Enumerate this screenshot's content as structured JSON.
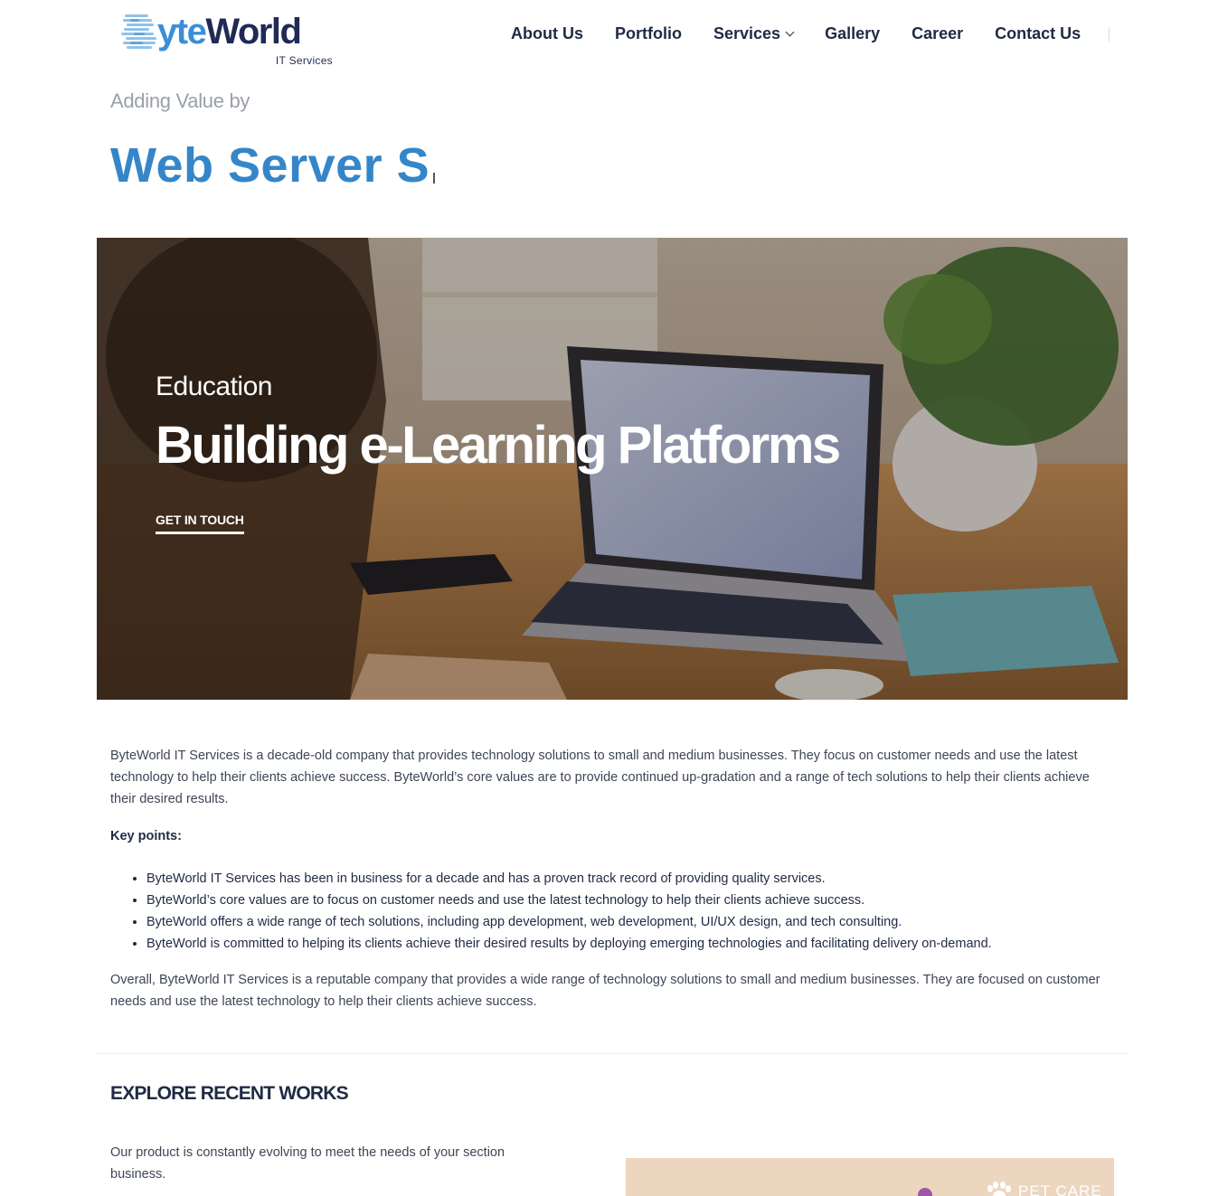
{
  "brand": {
    "logo_prefix": "yte",
    "logo_suffix": "World",
    "logo_tagline": "IT Services",
    "primary_color": "#3586c8",
    "dark_color": "#1f2a44"
  },
  "nav": {
    "items": [
      {
        "label": "About Us"
      },
      {
        "label": "Portfolio"
      },
      {
        "label": "Services",
        "has_dropdown": true
      },
      {
        "label": "Gallery"
      },
      {
        "label": "Career"
      },
      {
        "label": "Contact Us"
      }
    ]
  },
  "hero": {
    "subtitle": "Adding Value by",
    "typed_text": "Web Server S"
  },
  "banner": {
    "category": "Education",
    "title": "Building e-Learning Platforms",
    "cta": "GET IN TOUCH"
  },
  "content": {
    "intro": "ByteWorld IT Services is a decade-old company that provides technology solutions to small and medium businesses. They focus on customer needs and use the latest technology to help their clients achieve success. ByteWorld’s core values are to provide continued up-gradation and a range of tech solutions to help their clients achieve their desired results.",
    "key_points_heading": "Key points:",
    "key_points": [
      "ByteWorld IT Services has been in business for a decade and has a proven track record of providing quality services.",
      "ByteWorld’s core values are to focus on customer needs and use the latest technology to help their clients achieve success.",
      "ByteWorld offers a wide range of tech solutions, including app development, web development, UI/UX design, and tech consulting.",
      "ByteWorld is committed to helping its clients achieve their desired results by deploying emerging technologies and facilitating delivery on-demand."
    ],
    "summary": "Overall, ByteWorld IT Services is a reputable company that provides a wide range of technology solutions to small and medium businesses. They are focused on customer needs and use the latest technology to help their clients achieve success."
  },
  "explore": {
    "title": "EXPLORE RECENT WORKS",
    "text": "Our product is constantly evolving to meet the needs of your section business.",
    "card_label": "PET CARE",
    "card_color": "#ecd6bf"
  },
  "icons": {
    "logo_mark": "striped-b-logo-icon",
    "dropdown": "chevron-down-icon",
    "card": "paw-icon"
  }
}
